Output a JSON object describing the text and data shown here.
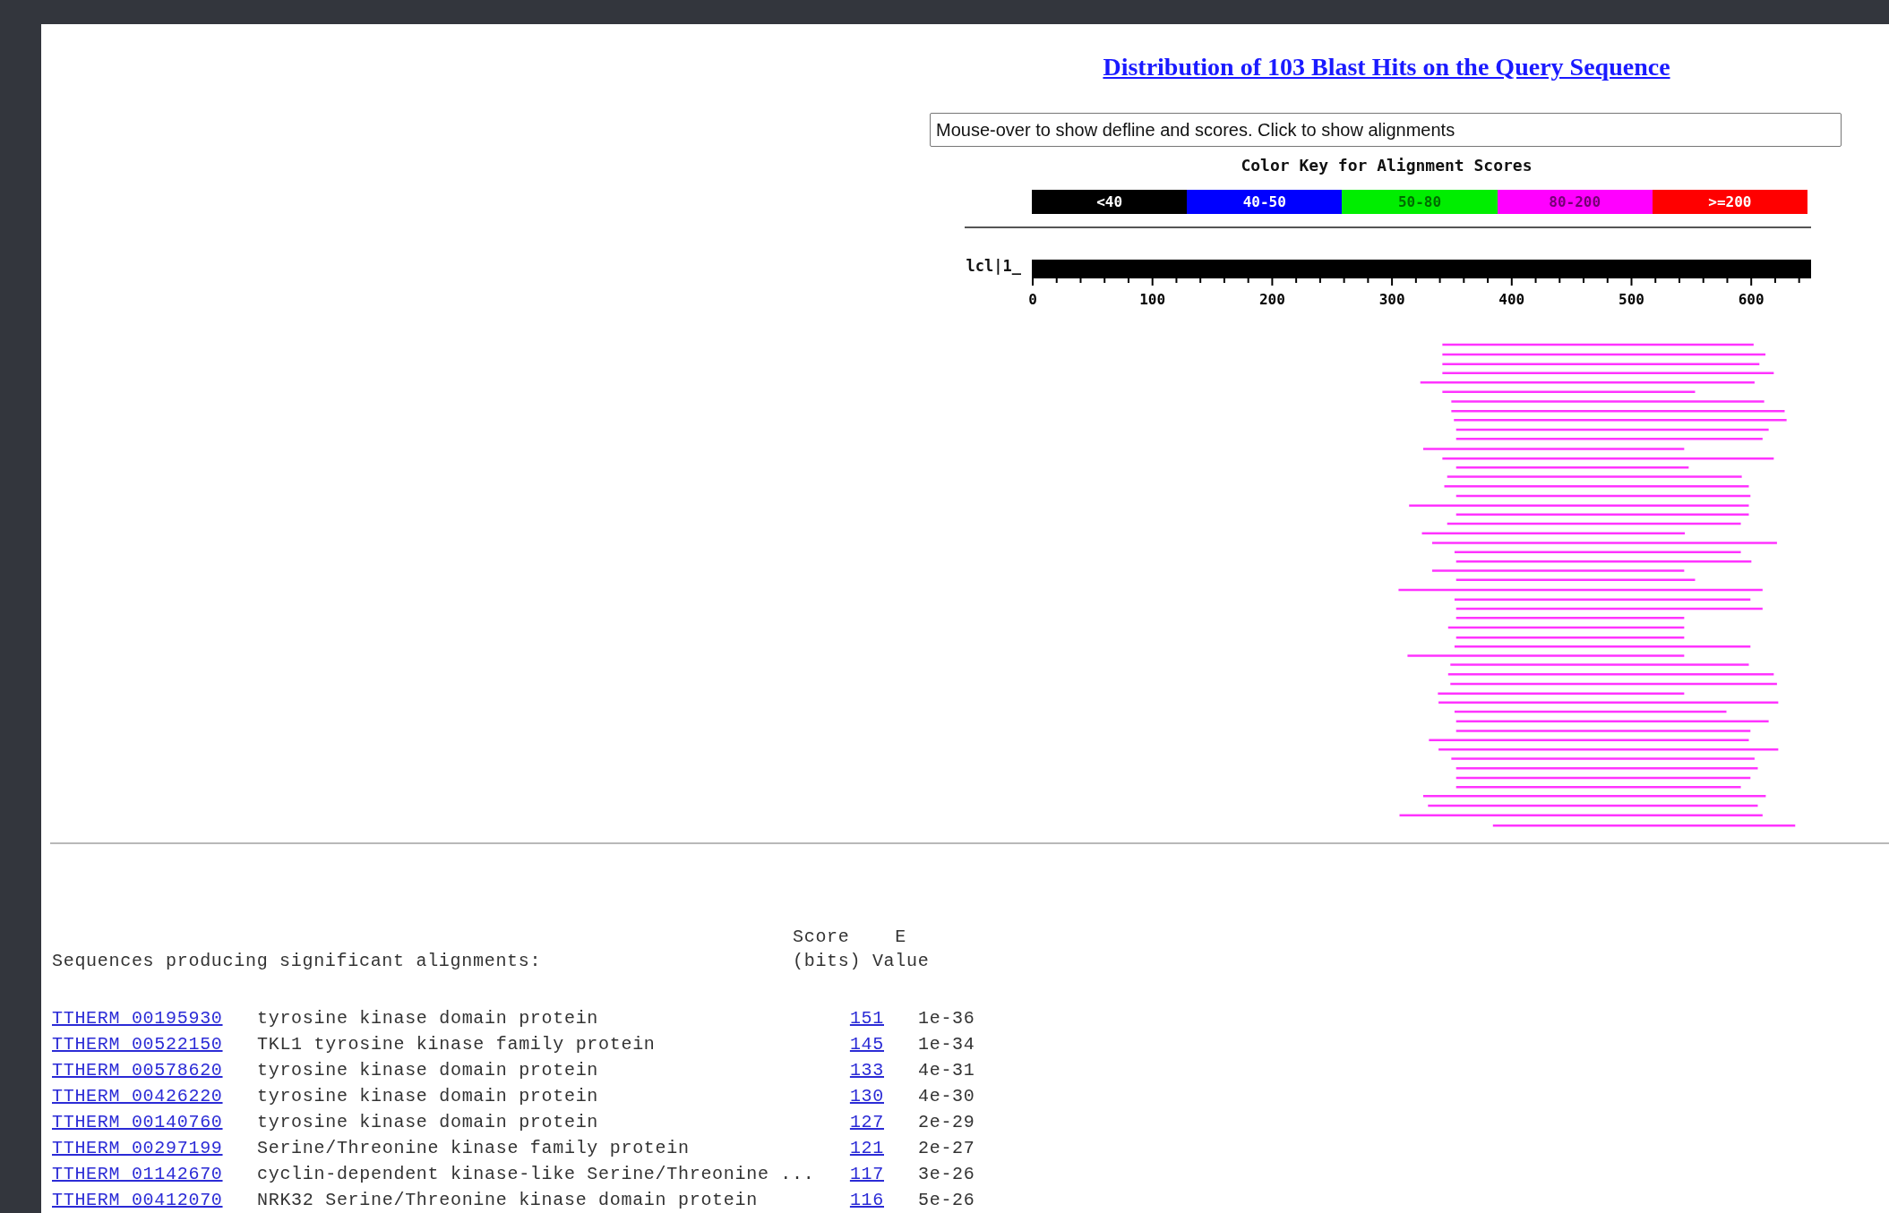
{
  "title": "Distribution of 103 Blast Hits on the Query Sequence",
  "info_field": {
    "value": "Mouse-over to show defline and scores. Click to show alignments"
  },
  "color_key": {
    "title": "Color Key for Alignment Scores",
    "ranges": [
      {
        "label": "<40",
        "color": "#000000"
      },
      {
        "label": "40-50",
        "color": "#0000ff"
      },
      {
        "label": "50-80",
        "color": "#00ee00"
      },
      {
        "label": "80-200",
        "color": "#ff00ff"
      },
      {
        "label": ">=200",
        "color": "#ff0000"
      }
    ]
  },
  "query": {
    "label": "lcl|1_",
    "ticks": [
      "0",
      "100",
      "200",
      "300",
      "400",
      "500",
      "600"
    ]
  },
  "table": {
    "score_header": [
      "Score    E",
      "(bits) Value"
    ],
    "caption": "Sequences producing significant alignments:",
    "rows": [
      {
        "id": "TTHERM_00195930",
        "description": "tyrosine kinase domain protein",
        "score": "151",
        "evalue": "1e-36"
      },
      {
        "id": "TTHERM_00522150",
        "description": "TKL1 tyrosine kinase family protein",
        "score": "145",
        "evalue": "1e-34"
      },
      {
        "id": "TTHERM_00578620",
        "description": "tyrosine kinase domain protein",
        "score": "133",
        "evalue": "4e-31"
      },
      {
        "id": "TTHERM_00426220",
        "description": "tyrosine kinase domain protein",
        "score": "130",
        "evalue": "4e-30"
      },
      {
        "id": "TTHERM_00140760",
        "description": "tyrosine kinase domain protein",
        "score": "127",
        "evalue": "2e-29"
      },
      {
        "id": "TTHERM_00297199",
        "description": "Serine/Threonine kinase family protein",
        "score": "121",
        "evalue": "2e-27"
      },
      {
        "id": "TTHERM_01142670",
        "description": "cyclin-dependent kinase-like Serine/Threonine ...",
        "score": "117",
        "evalue": "3e-26"
      },
      {
        "id": "TTHERM_00412070",
        "description": "NRK32 Serine/Threonine kinase domain protein",
        "score": "116",
        "evalue": "5e-26"
      }
    ]
  }
}
